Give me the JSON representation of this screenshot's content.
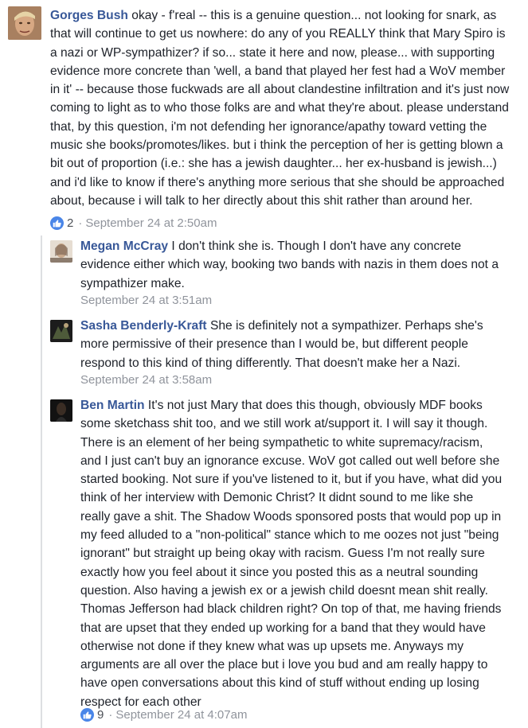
{
  "comments": [
    {
      "author": "Gorges Bush",
      "text": "okay - f'real -- this is a genuine question... not looking for snark, as that will continue to get us nowhere: do any of you REALLY think that Mary Spiro is a nazi or WP-sympathizer? if so... state it here and now, please... with supporting evidence more concrete than 'well, a band that played her fest had a WoV member in it' -- because those fuckwads are all about clandestine infiltration and it's just now coming to light as to who those folks are and what they're about. please understand that, by this question, i'm not defending her ignorance/apathy toward vetting the music she books/promotes/likes. but i think the perception of her is getting blown a bit out of proportion (i.e.: she has a jewish daughter... her ex-husband is jewish...) and i'd like to know if there's anything more serious that she should be approached about, because i will talk to her directly about this shit rather than around her.",
      "likes": "2",
      "separator": "·",
      "timestamp": "September 24 at 2:50am"
    },
    {
      "author": "Megan McCray",
      "text": "I don't think she is. Though I don't have any concrete evidence either which way, booking two bands with nazis in them does not a sympathizer make.",
      "timestamp": "September 24 at 3:51am"
    },
    {
      "author": "Sasha Benderly-Kraft",
      "text": "She is definitely not a sympathizer. Perhaps she's more permissive of their presence than I would be, but different people respond to this kind of thing differently. That doesn't make her a Nazi.",
      "timestamp": "September 24 at 3:58am"
    },
    {
      "author": "Ben Martin",
      "text": "It's not just Mary that does this though, obviously MDF books some sketchass shit too, and we still work at/support it. I will say it though. There is an element of her being sympathetic to white supremacy/racism, and I just can't buy an ignorance excuse. WoV got called out well before she started booking. Not sure if you've listened to it, but if you have, what did you think of her interview with Demonic Christ? It didnt sound to me like she really gave a shit. The Shadow Woods sponsored posts that would pop up in my feed alluded to a \"non-political\" stance which to me oozes not just \"being ignorant\" but straight up being okay with racism. Guess I'm not really sure exactly how you feel about it since you posted this as a neutral sounding question. Also having a jewish ex or a jewish child doesnt mean shit really. Thomas Jefferson had black children right? On top of that, me having friends that are upset that they ended up working for a band that they would have otherwise not done if they knew what was up upsets me. Anyways my arguments are all over the place but i love you bud and am really happy to have open conversations about this kind of stuff without ending up losing respect for each other",
      "likes": "9",
      "separator": "·",
      "timestamp": "September 24 at 4:07am"
    }
  ],
  "colors": {
    "author": "#385898",
    "meta": "#90949c",
    "like": "#4a86e8",
    "thread_line": "#dddfe2"
  },
  "icons": {
    "like": "thumbs-up-icon"
  }
}
